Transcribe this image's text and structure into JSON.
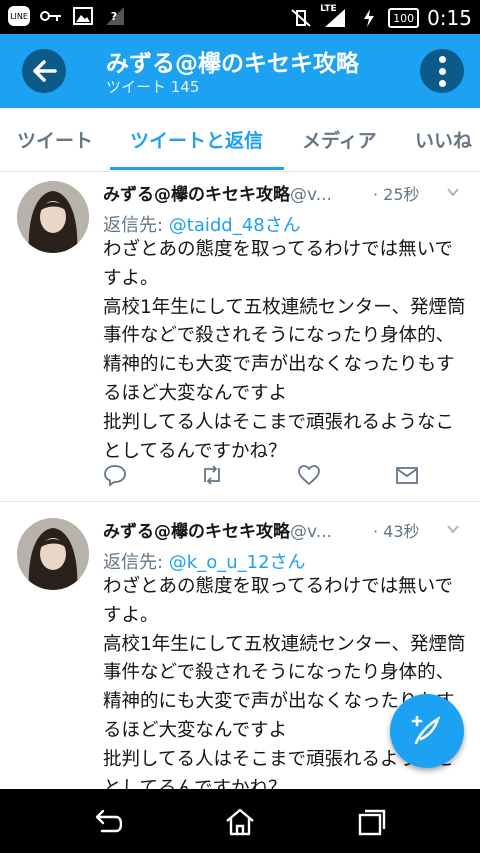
{
  "status_bar": {
    "line_label": "LINE",
    "signal_label": "?",
    "lte_label": "LTE",
    "battery": "100",
    "time": "0:15"
  },
  "app_bar": {
    "title": "みずる@欅のキセキ攻略",
    "subtitle": "ツイート 145"
  },
  "tabs": [
    {
      "label": "ツイート",
      "active": false
    },
    {
      "label": "ツイートと返信",
      "active": true
    },
    {
      "label": "メディア",
      "active": false
    },
    {
      "label": "いいね",
      "active": false
    }
  ],
  "tweets": [
    {
      "author": "みずる@欅のキセキ攻略",
      "handle": "@v...",
      "time": "· 25秒",
      "reply_prefix": "返信先: ",
      "reply_to": "@taidd_48さん",
      "text": "わざとあの態度を取ってるわけでは無いですよ。\n高校1年生にして五枚連続センター、発煙筒事件などで殺されそうになったり身体的、精神的にも大変で声が出なくなったりもするほど大変なんですよ\n批判してる人はそこまで頑張れるようなことしてるんですかね？"
    },
    {
      "author": "みずる@欅のキセキ攻略",
      "handle": "@v...",
      "time": "· 43秒",
      "reply_prefix": "返信先: ",
      "reply_to": "@k_o_u_12さん",
      "text": "わざとあの態度を取ってるわけでは無いですよ。\n高校1年生にして五枚連続センター、発煙筒事件などで殺されそうになったり身体的、精神的にも大変で声が出なくなったりもするほど大変なんですよ\n批判してる人はそこまで頑張れるようなことしてるんですかね？"
    }
  ],
  "colors": {
    "accent": "#1da1f2",
    "app_bar_button": "#0c5a8a",
    "muted_text": "#657786"
  }
}
